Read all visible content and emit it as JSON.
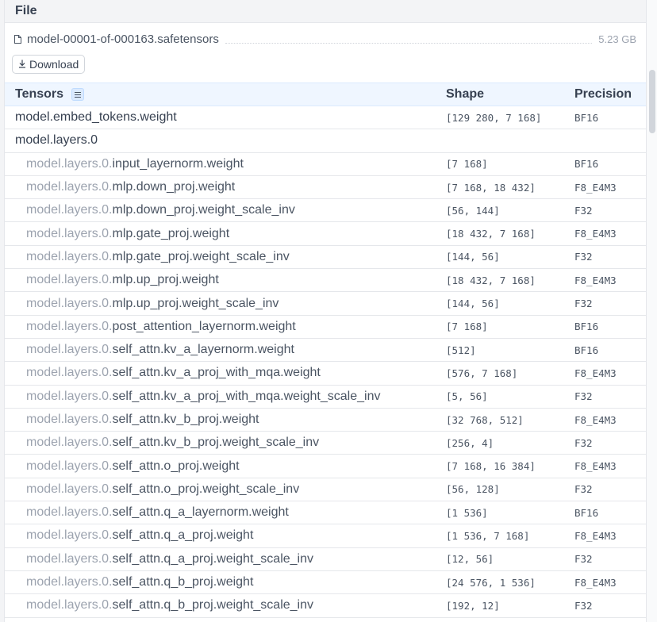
{
  "header": {
    "title": "File"
  },
  "file": {
    "name": "model-00001-of-000163.safetensors",
    "size": "5.23 GB",
    "download_label": "Download",
    "icons": {
      "file": "file-icon",
      "download": "download-icon"
    }
  },
  "table": {
    "columns": {
      "name": "Tensors",
      "shape": "Shape",
      "precision": "Precision"
    },
    "rows": [
      {
        "name": "model.embed_tokens.weight",
        "shape": "[129 280, 7 168]",
        "precision": "BF16"
      },
      {
        "name": "model.layers.0",
        "shape": "",
        "precision": ""
      },
      {
        "prefix": "model.layers.0.",
        "suffix": "input_layernorm.weight",
        "shape": "[7 168]",
        "precision": "BF16"
      },
      {
        "prefix": "model.layers.0.",
        "suffix": "mlp.down_proj.weight",
        "shape": "[7 168, 18 432]",
        "precision": "F8_E4M3"
      },
      {
        "prefix": "model.layers.0.",
        "suffix": "mlp.down_proj.weight_scale_inv",
        "shape": "[56, 144]",
        "precision": "F32"
      },
      {
        "prefix": "model.layers.0.",
        "suffix": "mlp.gate_proj.weight",
        "shape": "[18 432, 7 168]",
        "precision": "F8_E4M3"
      },
      {
        "prefix": "model.layers.0.",
        "suffix": "mlp.gate_proj.weight_scale_inv",
        "shape": "[144, 56]",
        "precision": "F32"
      },
      {
        "prefix": "model.layers.0.",
        "suffix": "mlp.up_proj.weight",
        "shape": "[18 432, 7 168]",
        "precision": "F8_E4M3"
      },
      {
        "prefix": "model.layers.0.",
        "suffix": "mlp.up_proj.weight_scale_inv",
        "shape": "[144, 56]",
        "precision": "F32"
      },
      {
        "prefix": "model.layers.0.",
        "suffix": "post_attention_layernorm.weight",
        "shape": "[7 168]",
        "precision": "BF16"
      },
      {
        "prefix": "model.layers.0.",
        "suffix": "self_attn.kv_a_layernorm.weight",
        "shape": "[512]",
        "precision": "BF16"
      },
      {
        "prefix": "model.layers.0.",
        "suffix": "self_attn.kv_a_proj_with_mqa.weight",
        "shape": "[576, 7 168]",
        "precision": "F8_E4M3"
      },
      {
        "prefix": "model.layers.0.",
        "suffix": "self_attn.kv_a_proj_with_mqa.weight_scale_inv",
        "shape": "[5, 56]",
        "precision": "F32"
      },
      {
        "prefix": "model.layers.0.",
        "suffix": "self_attn.kv_b_proj.weight",
        "shape": "[32 768, 512]",
        "precision": "F8_E4M3"
      },
      {
        "prefix": "model.layers.0.",
        "suffix": "self_attn.kv_b_proj.weight_scale_inv",
        "shape": "[256, 4]",
        "precision": "F32"
      },
      {
        "prefix": "model.layers.0.",
        "suffix": "self_attn.o_proj.weight",
        "shape": "[7 168, 16 384]",
        "precision": "F8_E4M3"
      },
      {
        "prefix": "model.layers.0.",
        "suffix": "self_attn.o_proj.weight_scale_inv",
        "shape": "[56, 128]",
        "precision": "F32"
      },
      {
        "prefix": "model.layers.0.",
        "suffix": "self_attn.q_a_layernorm.weight",
        "shape": "[1 536]",
        "precision": "BF16"
      },
      {
        "prefix": "model.layers.0.",
        "suffix": "self_attn.q_a_proj.weight",
        "shape": "[1 536, 7 168]",
        "precision": "F8_E4M3"
      },
      {
        "prefix": "model.layers.0.",
        "suffix": "self_attn.q_a_proj.weight_scale_inv",
        "shape": "[12, 56]",
        "precision": "F32"
      },
      {
        "prefix": "model.layers.0.",
        "suffix": "self_attn.q_b_proj.weight",
        "shape": "[24 576, 1 536]",
        "precision": "F8_E4M3"
      },
      {
        "prefix": "model.layers.0.",
        "suffix": "self_attn.q_b_proj.weight_scale_inv",
        "shape": "[192, 12]",
        "precision": "F32"
      }
    ]
  },
  "colors": {
    "header_bg": "#f3f4f6",
    "table_header_bg": "#eff6ff",
    "prefix_text": "#9ca3af",
    "name_text": "#4b5563"
  }
}
